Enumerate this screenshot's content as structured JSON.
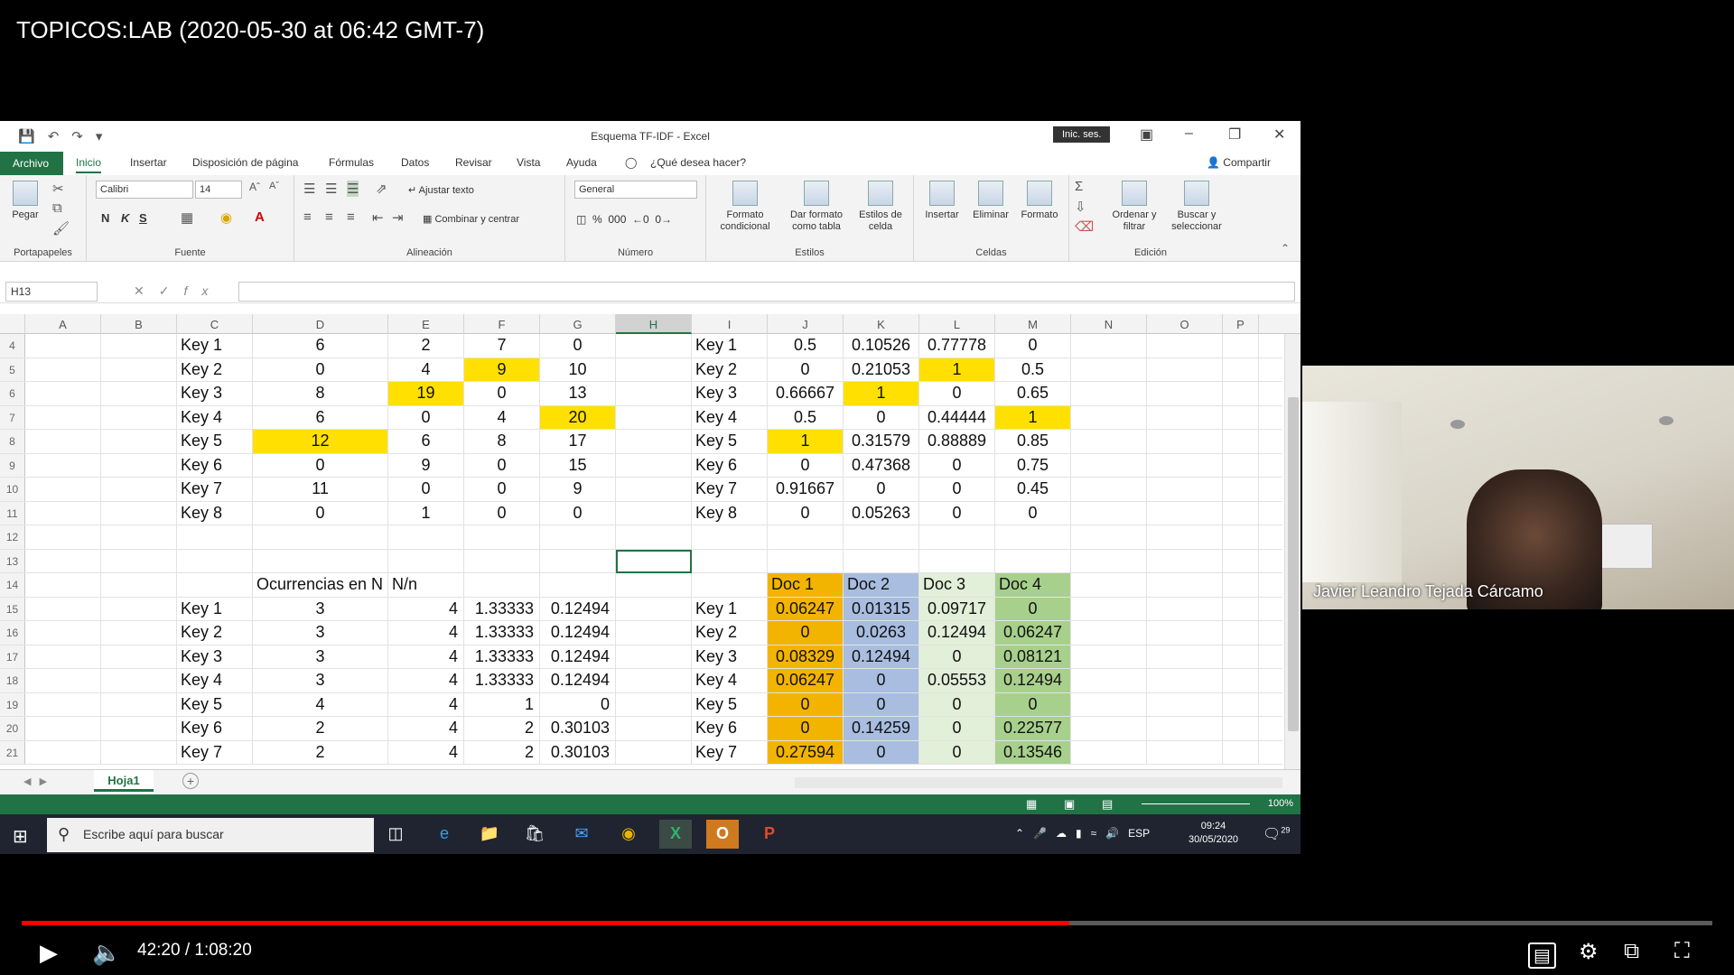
{
  "video": {
    "title": "TOPICOS:LAB (2020-05-30 at 06:42 GMT-7)",
    "current_time": "42:20",
    "duration": "1:08:20",
    "time_display": "42:20 / 1:08:20",
    "progress": 0.6196
  },
  "excel": {
    "doc_title": "Esquema TF-IDF  -  Excel",
    "sign_in": "Inic. ses.",
    "tabs": [
      "Archivo",
      "Inicio",
      "Insertar",
      "Disposición de página",
      "Fórmulas",
      "Datos",
      "Revisar",
      "Vista",
      "Ayuda"
    ],
    "tell_me": "¿Qué desea hacer?",
    "share": "Compartir",
    "ribbon": {
      "paste": "Pegar",
      "font_name": "Calibri",
      "font_size": "14",
      "bold": "N",
      "italic": "K",
      "underline": "S",
      "wrap_text": "Ajustar texto",
      "merge_center": "Combinar y centrar",
      "number_format": "General",
      "cond_format": "Formato condicional",
      "format_table": "Dar formato como tabla",
      "cell_styles": "Estilos de celda",
      "insert": "Insertar",
      "delete": "Eliminar",
      "format": "Formato",
      "sort_filter": "Ordenar y filtrar",
      "find_select": "Buscar y seleccionar",
      "groups": [
        "Portapapeles",
        "Fuente",
        "Alineación",
        "Número",
        "Estilos",
        "Celdas",
        "Edición"
      ]
    },
    "name_box": "H13",
    "columns": [
      "A",
      "B",
      "C",
      "D",
      "E",
      "F",
      "G",
      "H",
      "I",
      "J",
      "K",
      "L",
      "M",
      "N",
      "O",
      "P"
    ],
    "row_numbers": [
      "4",
      "5",
      "6",
      "7",
      "8",
      "9",
      "10",
      "11",
      "12",
      "13",
      "14",
      "15",
      "16",
      "17",
      "18",
      "19",
      "20",
      "21"
    ],
    "rows": [
      {
        "C": "Key 1",
        "D": "6",
        "E": "2",
        "F": "7",
        "G": "0",
        "I": "Key 1",
        "J": "0.5",
        "K": "0.10526",
        "L": "0.77778",
        "M": "0"
      },
      {
        "C": "Key 2",
        "D": "0",
        "E": "4",
        "F": "9",
        "G": "10",
        "I": "Key 2",
        "J": "0",
        "K": "0.21053",
        "L": "1",
        "M": "0.5"
      },
      {
        "C": "Key 3",
        "D": "8",
        "E": "19",
        "F": "0",
        "G": "13",
        "I": "Key 3",
        "J": "0.66667",
        "K": "1",
        "L": "0",
        "M": "0.65"
      },
      {
        "C": "Key 4",
        "D": "6",
        "E": "0",
        "F": "4",
        "G": "20",
        "I": "Key 4",
        "J": "0.5",
        "K": "0",
        "L": "0.44444",
        "M": "1"
      },
      {
        "C": "Key 5",
        "D": "12",
        "E": "6",
        "F": "8",
        "G": "17",
        "I": "Key 5",
        "J": "1",
        "K": "0.31579",
        "L": "0.88889",
        "M": "0.85"
      },
      {
        "C": "Key 6",
        "D": "0",
        "E": "9",
        "F": "0",
        "G": "15",
        "I": "Key 6",
        "J": "0",
        "K": "0.47368",
        "L": "0",
        "M": "0.75"
      },
      {
        "C": "Key 7",
        "D": "11",
        "E": "0",
        "F": "0",
        "G": "9",
        "I": "Key 7",
        "J": "0.91667",
        "K": "0",
        "L": "0",
        "M": "0.45"
      },
      {
        "C": "Key 8",
        "D": "0",
        "E": "1",
        "F": "0",
        "G": "0",
        "I": "Key 8",
        "J": "0",
        "K": "0.05263",
        "L": "0",
        "M": "0"
      },
      {},
      {},
      {
        "D": "Ocurrencias en N",
        "E": "N/n",
        "J": "Doc 1",
        "K": "Doc 2",
        "L": "Doc 3",
        "M": "Doc 4"
      },
      {
        "C": "Key 1",
        "D": "3",
        "E": "4",
        "F": "1.33333",
        "G": "0.12494",
        "I": "Key 1",
        "J": "0.06247",
        "K": "0.01315",
        "L": "0.09717",
        "M": "0"
      },
      {
        "C": "Key 2",
        "D": "3",
        "E": "4",
        "F": "1.33333",
        "G": "0.12494",
        "I": "Key 2",
        "J": "0",
        "K": "0.0263",
        "L": "0.12494",
        "M": "0.06247"
      },
      {
        "C": "Key 3",
        "D": "3",
        "E": "4",
        "F": "1.33333",
        "G": "0.12494",
        "I": "Key 3",
        "J": "0.08329",
        "K": "0.12494",
        "L": "0",
        "M": "0.08121"
      },
      {
        "C": "Key 4",
        "D": "3",
        "E": "4",
        "F": "1.33333",
        "G": "0.12494",
        "I": "Key 4",
        "J": "0.06247",
        "K": "0",
        "L": "0.05553",
        "M": "0.12494"
      },
      {
        "C": "Key 5",
        "D": "4",
        "E": "4",
        "F": "1",
        "G": "0",
        "I": "Key 5",
        "J": "0",
        "K": "0",
        "L": "0",
        "M": "0"
      },
      {
        "C": "Key 6",
        "D": "2",
        "E": "4",
        "F": "2",
        "G": "0.30103",
        "I": "Key 6",
        "J": "0",
        "K": "0.14259",
        "L": "0",
        "M": "0.22577"
      },
      {
        "C": "Key 7",
        "D": "2",
        "E": "4",
        "F": "2",
        "G": "0.30103",
        "I": "Key 7",
        "J": "0.27594",
        "K": "0",
        "L": "0",
        "M": "0.13546"
      }
    ],
    "highlight_colors": {
      "yellow": "#ffe000",
      "orange": "#f3b400",
      "blue": "#a8bde0",
      "light_green": "#e2efd9",
      "green": "#a8d08d",
      "excel_green": "#217346"
    },
    "sheet_tab": "Hoja1",
    "zoom": "100%"
  },
  "taskbar": {
    "search_placeholder": "Escribe aquí para buscar",
    "language": "ESP",
    "time": "09:24",
    "date": "30/05/2020",
    "notifications": "29"
  },
  "webcam": {
    "speaker_name": "Javier Leandro Tejada Cárcamo"
  }
}
